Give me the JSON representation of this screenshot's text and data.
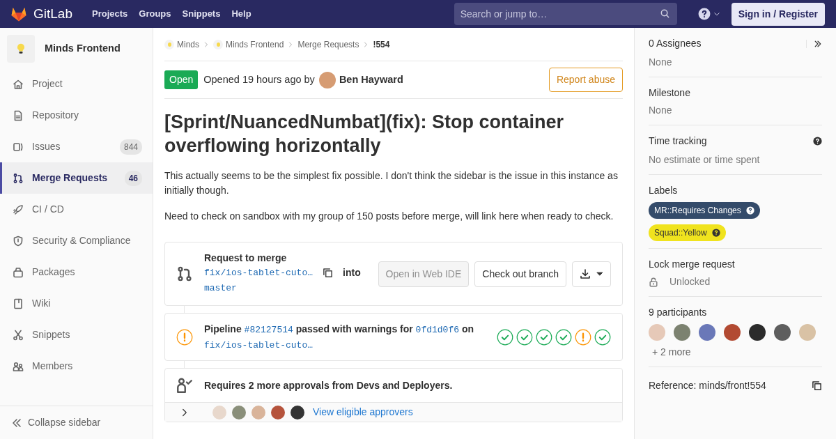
{
  "navbar": {
    "brand": "GitLab",
    "links": [
      "Projects",
      "Groups",
      "Snippets",
      "Help"
    ],
    "search": {
      "placeholder": "Search or jump to…"
    },
    "sign_in": "Sign in / Register"
  },
  "sidebar": {
    "project": "Minds Frontend",
    "items": [
      {
        "label": "Project",
        "selected": false
      },
      {
        "label": "Repository",
        "selected": false
      },
      {
        "label": "Issues",
        "count": "844",
        "selected": false
      },
      {
        "label": "Merge Requests",
        "count": "46",
        "selected": true
      },
      {
        "label": "CI / CD",
        "selected": false
      },
      {
        "label": "Security & Compliance",
        "selected": false
      },
      {
        "label": "Packages",
        "selected": false
      },
      {
        "label": "Wiki",
        "selected": false
      },
      {
        "label": "Snippets",
        "selected": false
      },
      {
        "label": "Members",
        "selected": false
      }
    ],
    "collapse": "Collapse sidebar"
  },
  "breadcrumbs": [
    {
      "kind": "group",
      "label": "Minds"
    },
    {
      "kind": "group",
      "label": "Minds Frontend"
    },
    {
      "kind": "page",
      "label": "Merge Requests"
    },
    {
      "kind": "current",
      "label": "!554"
    }
  ],
  "header": {
    "status": "Open",
    "opened": "Opened 19 hours ago by",
    "author": "Ben Hayward",
    "report": "Report abuse"
  },
  "title": "[Sprint/NuancedNumbat](fix): Stop container overflowing horizontally",
  "description": [
    "This actually seems to be the simplest fix possible. I don't think the sidebar is the issue in this instance as initially though.",
    "Need to check on sandbox with my group of 150 posts before merge, will link here when ready to check."
  ],
  "merge_widget": {
    "heading": "Request to merge",
    "source_branch": "fix/ios-tablet-cuto…",
    "into": "into",
    "target_branch": "master",
    "buttons": [
      {
        "label": "Open in Web IDE",
        "disabled": true
      },
      {
        "label": "Check out branch",
        "disabled": false
      }
    ]
  },
  "pipeline": {
    "prefix": "Pipeline",
    "id": "#82127514",
    "middle": "passed with warnings for",
    "commit": "0fd1d0f6",
    "on": "on",
    "branch": "fix/ios-tablet-cuto…",
    "stages": [
      {
        "kind": "success"
      },
      {
        "kind": "success"
      },
      {
        "kind": "success"
      },
      {
        "kind": "success"
      },
      {
        "kind": "warning"
      },
      {
        "kind": "success"
      }
    ]
  },
  "approvals": {
    "text": "Requires 2 more approvals from Devs and Deployers.",
    "approvers": [
      {
        "color": "#e8d8cc"
      },
      {
        "color": "#8a8f7a"
      },
      {
        "color": "#d9b49a"
      },
      {
        "color": "#b5533c"
      },
      {
        "color": "#333333"
      }
    ],
    "link": "View eligible approvers"
  },
  "right_sidebar": {
    "assignees": {
      "title": "0 Assignees",
      "value": "None"
    },
    "milestone": {
      "title": "Milestone",
      "value": "None"
    },
    "time_tracking": {
      "title": "Time tracking",
      "value": "No estimate or time spent"
    },
    "labels": {
      "title": "Labels",
      "items": [
        {
          "text": "MR::Requires Changes",
          "color": "#344b6a"
        },
        {
          "text": "Squad::Yellow",
          "color": "#f0e31e"
        }
      ]
    },
    "lock": {
      "title": "Lock merge request",
      "value": "Unlocked"
    },
    "participants": {
      "title": "9 participants",
      "avatars": [
        {
          "color": "#e6c9b8"
        },
        {
          "color": "#7c8270"
        },
        {
          "color": "#6a78b8"
        },
        {
          "color": "#b24a32"
        },
        {
          "color": "#2b2b2b"
        },
        {
          "color": "#5e5e5e"
        },
        {
          "color": "#d9c2a5"
        }
      ],
      "more": "+ 2 more"
    },
    "reference": "Reference: minds/front!554"
  }
}
